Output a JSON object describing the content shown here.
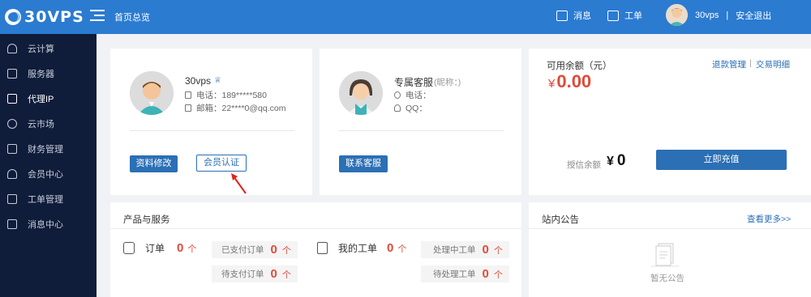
{
  "topbar": {
    "logo_text": "30VPS",
    "home_label": "首页总览",
    "messages_label": "消息",
    "tickets_label": "工单",
    "username": "30vps",
    "separator": "|",
    "logout_label": "安全退出"
  },
  "sidebar": {
    "items": [
      {
        "label": "云计算",
        "icon": "cloud-icon"
      },
      {
        "label": "服务器",
        "icon": "server-icon"
      },
      {
        "label": "代理IP",
        "icon": "monitor-icon",
        "active": true
      },
      {
        "label": "云市场",
        "icon": "market-icon"
      },
      {
        "label": "财务管理",
        "icon": "finance-icon"
      },
      {
        "label": "会员中心",
        "icon": "user-icon"
      },
      {
        "label": "工单管理",
        "icon": "ticket-icon"
      },
      {
        "label": "消息中心",
        "icon": "message-icon"
      }
    ]
  },
  "profile": {
    "name": "30vps",
    "phone": "电话：189*****580",
    "email": "邮箱：22****0@qq.com",
    "edit_button": "资料修改",
    "verify_button": "会员认证"
  },
  "service": {
    "title": "专属客服",
    "nickname": "(昵称：)",
    "phone": "电话：",
    "qq": "QQ：",
    "contact_button": "联系客服"
  },
  "balance": {
    "label": "可用余额（元）",
    "refund_link": "退款管理",
    "separator": "|",
    "transactions_link": "交易明细",
    "amount_symbol": "¥",
    "amount": "0.00",
    "credit_label": "授信余额",
    "credit_symbol": "¥",
    "credit_amount": "0",
    "recharge_button": "立即充值"
  },
  "products": {
    "title": "产品与服务",
    "orders_label": "订单",
    "orders_count": "0",
    "unit": "个",
    "paid_label": "已支付订单",
    "paid_count": "0",
    "unpaid_label": "待支付订单",
    "unpaid_count": "0",
    "tickets_label": "我的工单",
    "tickets_count": "0",
    "processing_label": "处理中工单",
    "processing_count": "0",
    "pending_label": "待处理工单",
    "pending_count": "0"
  },
  "notices": {
    "title": "站内公告",
    "more_link": "查看更多>>",
    "empty_text": "暂无公告"
  },
  "colors": {
    "topbar": "#2b7bd1",
    "sidebar": "#0f1c3a",
    "accent_red": "#e04a3a",
    "button_blue": "#2b6fb5"
  }
}
